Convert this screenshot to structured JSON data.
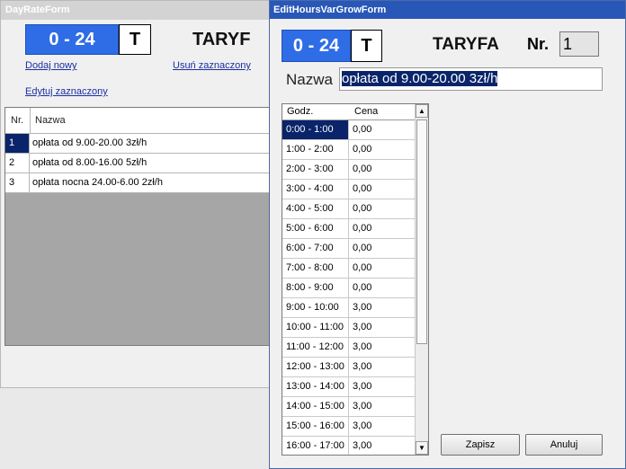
{
  "back_window": {
    "title": "DayRateForm",
    "range_badge": "0 - 24",
    "t_label": "T",
    "heading": "TARYF",
    "links": {
      "add_new": "Dodaj nowy",
      "delete_selected": "Usuń zaznaczony",
      "edit_selected": "Edytuj zaznaczony"
    },
    "grid": {
      "headers": [
        "Nr.",
        "Nazwa"
      ],
      "rows": [
        {
          "nr": "1",
          "name": "opłata od 9.00-20.00 3zł/h"
        },
        {
          "nr": "2",
          "name": "opłata od 8.00-16.00 5zł/h"
        },
        {
          "nr": "3",
          "name": "opłata nocna 24.00-6.00 2zł/h"
        }
      ]
    }
  },
  "front_window": {
    "title": "EditHoursVarGrowForm",
    "range_badge": "0 - 24",
    "t_label": "T",
    "heading": "TARYFA",
    "nr_label": "Nr.",
    "nr_value": "1",
    "name_label": "Nazwa",
    "name_value": "opłata od 9.00-20.00 3zł/h",
    "grid": {
      "headers": [
        "Godz.",
        "Cena"
      ],
      "rows": [
        {
          "hours": "0:00 - 1:00",
          "price": "0,00"
        },
        {
          "hours": "1:00 - 2:00",
          "price": "0,00"
        },
        {
          "hours": "2:00 - 3:00",
          "price": "0,00"
        },
        {
          "hours": "3:00 - 4:00",
          "price": "0,00"
        },
        {
          "hours": "4:00 - 5:00",
          "price": "0,00"
        },
        {
          "hours": "5:00 - 6:00",
          "price": "0,00"
        },
        {
          "hours": "6:00 - 7:00",
          "price": "0,00"
        },
        {
          "hours": "7:00 - 8:00",
          "price": "0,00"
        },
        {
          "hours": "8:00 - 9:00",
          "price": "0,00"
        },
        {
          "hours": "9:00 - 10:00",
          "price": "3,00"
        },
        {
          "hours": "10:00 - 11:00",
          "price": "3,00"
        },
        {
          "hours": "11:00 - 12:00",
          "price": "3,00"
        },
        {
          "hours": "12:00 - 13:00",
          "price": "3,00"
        },
        {
          "hours": "13:00 - 14:00",
          "price": "3,00"
        },
        {
          "hours": "14:00 - 15:00",
          "price": "3,00"
        },
        {
          "hours": "15:00 - 16:00",
          "price": "3,00"
        },
        {
          "hours": "16:00 - 17:00",
          "price": "3,00"
        }
      ]
    },
    "buttons": {
      "save": "Zapisz",
      "cancel": "Anuluj"
    }
  }
}
